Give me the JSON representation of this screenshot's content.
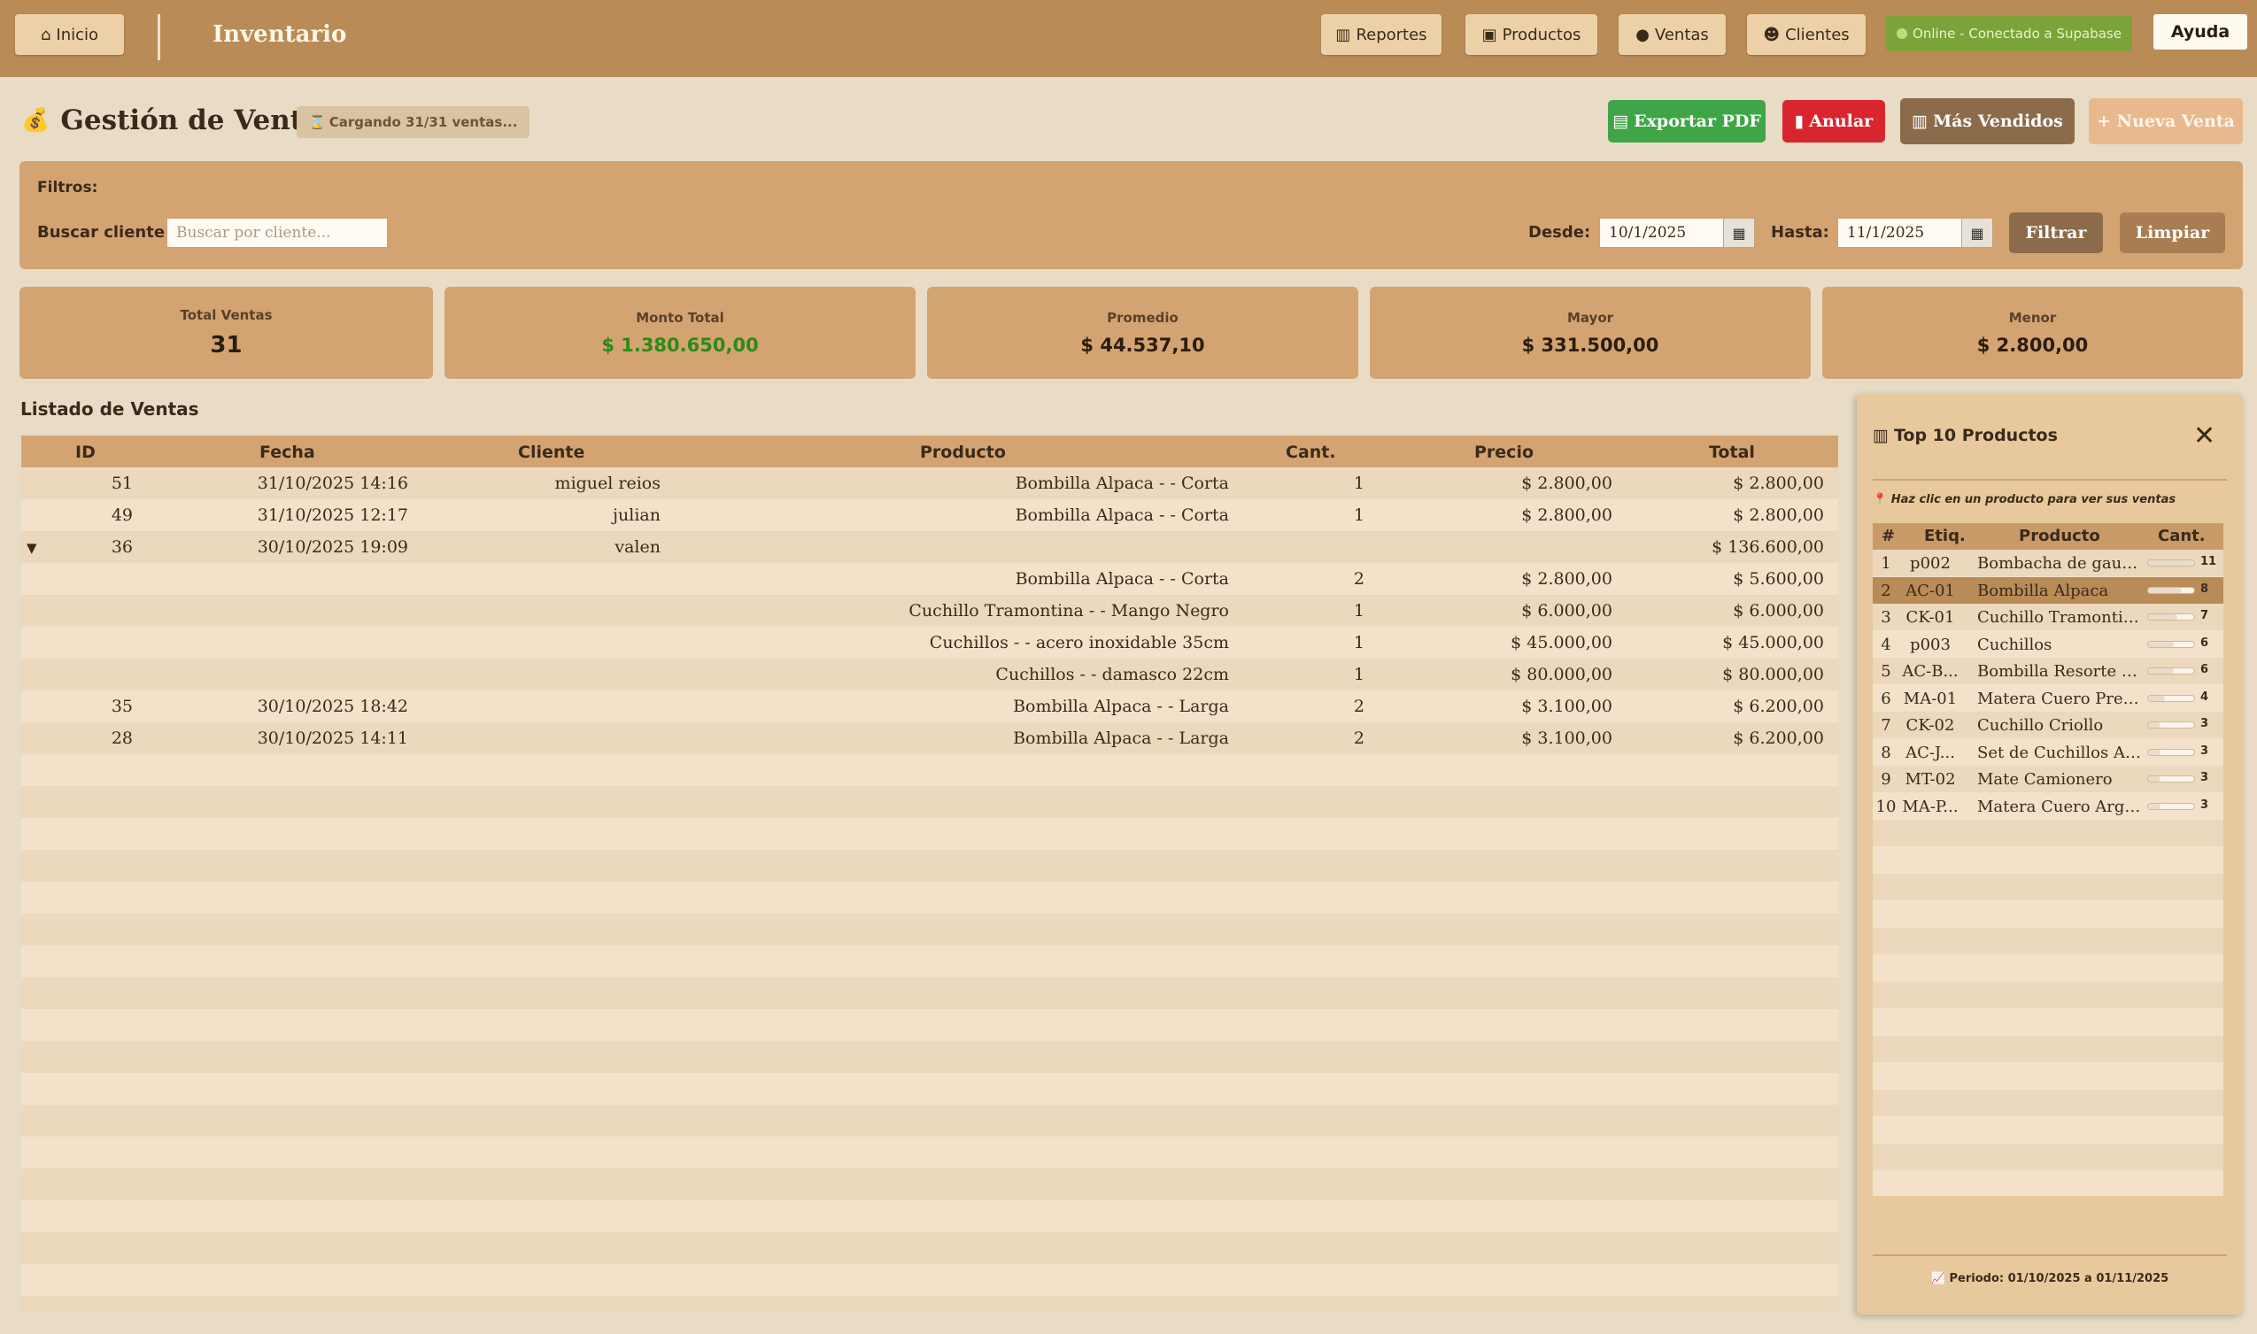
{
  "topbar": {
    "home_label": "Inicio",
    "app_title": "Inventario",
    "nav": [
      "Reportes",
      "Productos",
      "Ventas",
      "Clientes"
    ],
    "status": "Online - Conectado a Supabase",
    "help_label": "Ayuda"
  },
  "header": {
    "title": "Gestión de Ventas",
    "loading": "Cargando 31/31 ventas...",
    "actions": {
      "export_pdf": "Exportar PDF",
      "anular": "Anular",
      "mas_vendidos": "Más Vendidos",
      "nueva_venta": "+ Nueva Venta"
    }
  },
  "filters": {
    "title": "Filtros:",
    "search_label": "Buscar cliente:",
    "search_placeholder": "Buscar por cliente...",
    "from_label": "Desde:",
    "from_value": "10/1/2025",
    "to_label": "Hasta:",
    "to_value": "11/1/2025",
    "filter_button": "Filtrar",
    "clear_button": "Limpiar"
  },
  "stats": [
    {
      "label": "Total Ventas",
      "value": "31"
    },
    {
      "label": "Monto Total",
      "value": "$ 1.380.650,00"
    },
    {
      "label": "Promedio",
      "value": "$ 44.537,10"
    },
    {
      "label": "Mayor",
      "value": "$ 331.500,00"
    },
    {
      "label": "Menor",
      "value": "$ 2.800,00"
    }
  ],
  "sales": {
    "title": "Listado de Ventas",
    "columns": [
      "ID",
      "Fecha",
      "Cliente",
      "Producto",
      "Cant.",
      "Precio",
      "Total"
    ],
    "rows": [
      [
        "51",
        "31/10/2025 14:16",
        "miguel reios",
        "Bombilla Alpaca - - Corta",
        "1",
        "$ 2.800,00",
        "$ 2.800,00"
      ],
      [
        "49",
        "31/10/2025 12:17",
        "julian",
        "Bombilla Alpaca - - Corta",
        "1",
        "$ 2.800,00",
        "$ 2.800,00"
      ],
      [
        "36",
        "30/10/2025 19:09",
        "valen",
        "",
        "",
        "",
        "$ 136.600,00"
      ],
      [
        "",
        "",
        "",
        "Bombilla Alpaca - - Corta",
        "2",
        "$ 2.800,00",
        "$ 5.600,00"
      ],
      [
        "",
        "",
        "",
        "Cuchillo Tramontina - - Mango Negro",
        "1",
        "$ 6.000,00",
        "$ 6.000,00"
      ],
      [
        "",
        "",
        "",
        "Cuchillos - - acero inoxidable 35cm",
        "1",
        "$ 45.000,00",
        "$ 45.000,00"
      ],
      [
        "",
        "",
        "",
        "Cuchillos - - damasco 22cm",
        "1",
        "$ 80.000,00",
        "$ 80.000,00"
      ],
      [
        "35",
        "30/10/2025 18:42",
        "",
        "Bombilla Alpaca - - Larga",
        "2",
        "$ 3.100,00",
        "$ 6.200,00"
      ],
      [
        "28",
        "30/10/2025 14:11",
        "",
        "Bombilla Alpaca - - Larga",
        "2",
        "$ 3.100,00",
        "$ 6.200,00"
      ]
    ]
  },
  "top_products": {
    "title": "Top 10 Productos",
    "hint": "Haz clic en un producto para ver sus ventas",
    "columns": [
      "#",
      "Etiq.",
      "Producto",
      "Cant."
    ],
    "rows": [
      {
        "rank": "1",
        "tag": "p002",
        "name": "Bombacha de gaucho",
        "qty": "11",
        "pct": 1.0
      },
      {
        "rank": "2",
        "tag": "AC-01",
        "name": "Bombilla Alpaca",
        "qty": "8",
        "pct": 0.73
      },
      {
        "rank": "3",
        "tag": "CK-01",
        "name": "Cuchillo Tramontina",
        "qty": "7",
        "pct": 0.64
      },
      {
        "rank": "4",
        "tag": "p003",
        "name": "Cuchillos",
        "qty": "6",
        "pct": 0.55
      },
      {
        "rank": "5",
        "tag": "AC-B...",
        "name": "Bombilla Resorte Al...",
        "qty": "6",
        "pct": 0.55
      },
      {
        "rank": "6",
        "tag": "MA-01",
        "name": "Matera Cuero Prem...",
        "qty": "4",
        "pct": 0.36
      },
      {
        "rank": "7",
        "tag": "CK-02",
        "name": "Cuchillo Criollo",
        "qty": "3",
        "pct": 0.27
      },
      {
        "rank": "8",
        "tag": "AC-J...",
        "name": "Set de Cuchillos As...",
        "qty": "3",
        "pct": 0.27
      },
      {
        "rank": "9",
        "tag": "MT-02",
        "name": "Mate Camionero",
        "qty": "3",
        "pct": 0.27
      },
      {
        "rank": "10",
        "tag": "MA-P...",
        "name": "Matera Cuero Arge...",
        "qty": "3",
        "pct": 0.27
      }
    ],
    "selected_index": 1,
    "period": "Periodo: 01/10/2025 a 01/11/2025"
  }
}
